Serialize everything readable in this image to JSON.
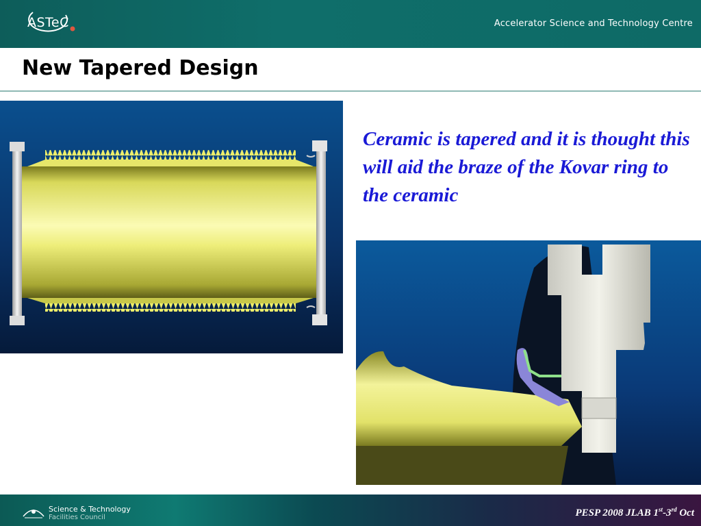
{
  "header": {
    "logo_text": "ASTeC",
    "org_name": "Accelerator Science and Technology Centre",
    "colors": {
      "band": "#0f6e6a",
      "logo_dot": "#e0573f"
    }
  },
  "slide": {
    "title": "New Tapered Design",
    "caption": "Ceramic is tapered and it is thought this will aid the braze of the Kovar ring to the ceramic",
    "caption_color": "#1a1ad6"
  },
  "images": {
    "left": {
      "icon": "ceramic-cylinder-render"
    },
    "right": {
      "icon": "kovar-braze-closeup-render"
    }
  },
  "footer": {
    "council_line1": "Science & Technology",
    "council_line2": "Facilities Council",
    "conference_prefix": "PESP 2008 JLAB 1",
    "conference_sup1": "st",
    "conference_mid": "-3",
    "conference_sup2": "rd",
    "conference_suffix": " Oct"
  }
}
